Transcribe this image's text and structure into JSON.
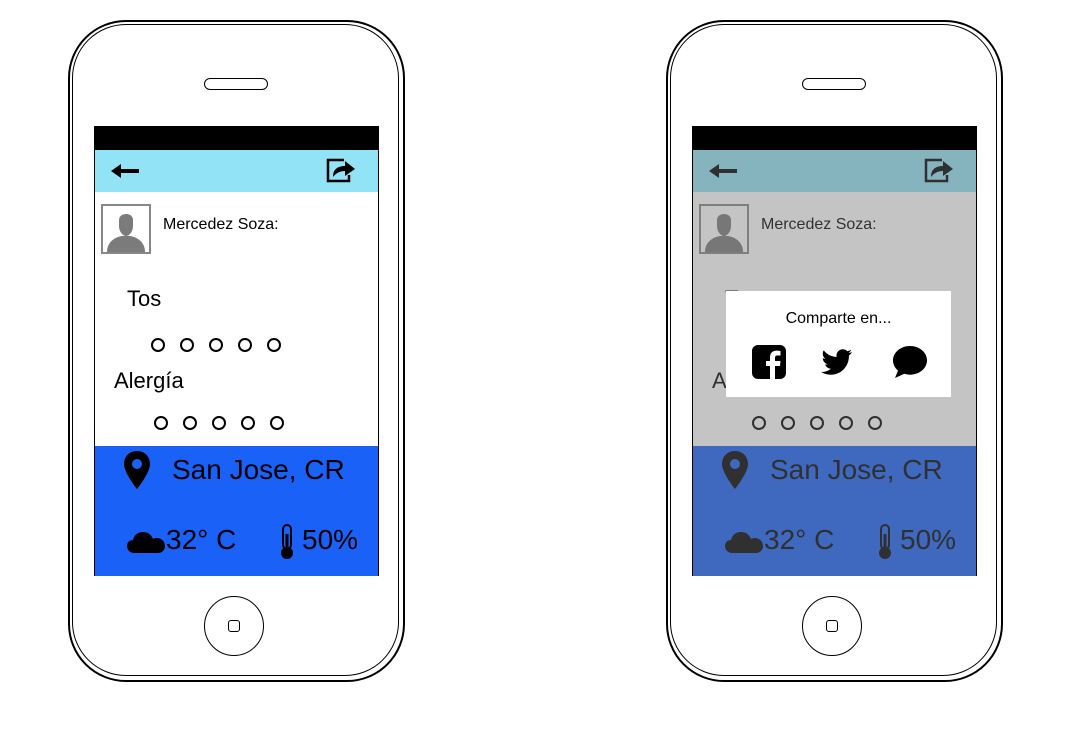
{
  "app": {
    "user_name": "Mercedez Soza:",
    "symptoms": [
      {
        "label": "Tos",
        "rating_options": 5
      },
      {
        "label": "Alergía",
        "rating_options": 5
      }
    ],
    "weather": {
      "location": "San Jose, CR",
      "temperature": "32° C",
      "humidity": "50%"
    },
    "icons": {
      "back": "arrow-left-icon",
      "share": "share-icon",
      "avatar": "user-avatar-icon",
      "location": "map-pin-icon",
      "weather": "cloud-icon",
      "humidity": "thermometer-icon"
    }
  },
  "share_dialog": {
    "title": "Comparte en...",
    "options": [
      {
        "name": "facebook-icon"
      },
      {
        "name": "twitter-icon"
      },
      {
        "name": "message-icon"
      }
    ]
  },
  "colors": {
    "app_bar": "#93e3f7",
    "weather_panel": "#1a61f7",
    "status_bar": "#000000",
    "overlay": "rgba(115,115,115,0.42)"
  }
}
